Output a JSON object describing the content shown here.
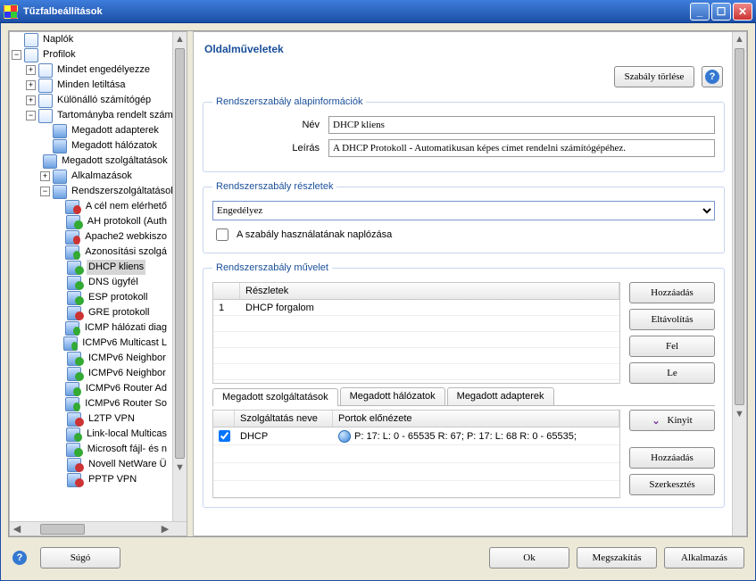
{
  "window": {
    "title": "Tűzfalbeállítások"
  },
  "tree": {
    "items": [
      {
        "label": "Naplók",
        "icon": "doc"
      },
      {
        "label": "Profilok",
        "icon": "doc",
        "exp": "-",
        "children": [
          {
            "label": "Mindet engedélyezze",
            "exp": "+",
            "icon": "doc"
          },
          {
            "label": "Minden letiltása",
            "exp": "+",
            "icon": "doc"
          },
          {
            "label": "Különálló számítógép",
            "exp": "+",
            "icon": "doc"
          },
          {
            "label": "Tartományba rendelt számító",
            "exp": "-",
            "icon": "doc",
            "children": [
              {
                "label": "Megadott adapterek",
                "icon": ""
              },
              {
                "label": "Megadott hálózatok",
                "icon": ""
              },
              {
                "label": "Megadott szolgáltatások",
                "icon": ""
              },
              {
                "label": "Alkalmazások",
                "exp": "+",
                "icon": ""
              },
              {
                "label": "Rendszerszolgáltatások",
                "exp": "-",
                "icon": "",
                "children": [
                  {
                    "label": "A cél nem elérhető",
                    "badge": "red"
                  },
                  {
                    "label": "AH protokoll (Auth",
                    "badge": "green"
                  },
                  {
                    "label": "Apache2 webkiszo",
                    "badge": "red"
                  },
                  {
                    "label": "Azonosítási szolgá",
                    "badge": "green"
                  },
                  {
                    "label": "DHCP kliens",
                    "badge": "green",
                    "selected": true
                  },
                  {
                    "label": "DNS ügyfél",
                    "badge": "green"
                  },
                  {
                    "label": "ESP protokoll",
                    "badge": "green"
                  },
                  {
                    "label": "GRE protokoll",
                    "badge": "red"
                  },
                  {
                    "label": "ICMP hálózati diag",
                    "badge": "green"
                  },
                  {
                    "label": "ICMPv6 Multicast L",
                    "badge": "green"
                  },
                  {
                    "label": "ICMPv6 Neighbor",
                    "badge": "green"
                  },
                  {
                    "label": "ICMPv6 Neighbor",
                    "badge": "green"
                  },
                  {
                    "label": "ICMPv6 Router Ad",
                    "badge": "green"
                  },
                  {
                    "label": "ICMPv6 Router So",
                    "badge": "green"
                  },
                  {
                    "label": "L2TP VPN",
                    "badge": "red"
                  },
                  {
                    "label": "Link-local Multicas",
                    "badge": "green"
                  },
                  {
                    "label": "Microsoft fájl- és n",
                    "badge": "green"
                  },
                  {
                    "label": "Novell NetWare Ü",
                    "badge": "red"
                  },
                  {
                    "label": "PPTP VPN",
                    "badge": "red"
                  }
                ]
              }
            ]
          }
        ]
      }
    ]
  },
  "page": {
    "title": "Oldalműveletek",
    "delete_rule_label": "Szabály törlése"
  },
  "basic": {
    "legend": "Rendszerszabály alapinformációk",
    "name_label": "Név",
    "name_value": "DHCP kliens",
    "desc_label": "Leírás",
    "desc_value": "A DHCP Protokoll - Automatikusan képes címet rendelni számítógépéhez."
  },
  "details": {
    "legend": "Rendszerszabály részletek",
    "allow_value": "Engedélyez",
    "log_label": "A szabály használatának naplózása"
  },
  "operation": {
    "legend": "Rendszerszabály művelet",
    "col_details": "Részletek",
    "rows": [
      {
        "n": "1",
        "details": "DHCP forgalom"
      }
    ],
    "btn_add": "Hozzáadás",
    "btn_remove": "Eltávolítás",
    "btn_up": "Fel",
    "btn_down": "Le"
  },
  "tabs": {
    "services": "Megadott szolgáltatások",
    "networks": "Megadott hálózatok",
    "adapters": "Megadott adapterek"
  },
  "svc": {
    "col_name": "Szolgáltatás neve",
    "col_ports": "Portok előnézete",
    "rows": [
      {
        "checked": true,
        "name": "DHCP",
        "ports": "P: 17:  L: 0 - 65535 R: 67; P: 17:  L: 68 R: 0 - 65535;"
      }
    ],
    "btn_open": "Kinyit",
    "btn_add": "Hozzáadás",
    "btn_edit": "Szerkesztés"
  },
  "footer": {
    "help": "Súgó",
    "ok": "Ok",
    "cancel": "Megszakítás",
    "apply": "Alkalmazás"
  }
}
